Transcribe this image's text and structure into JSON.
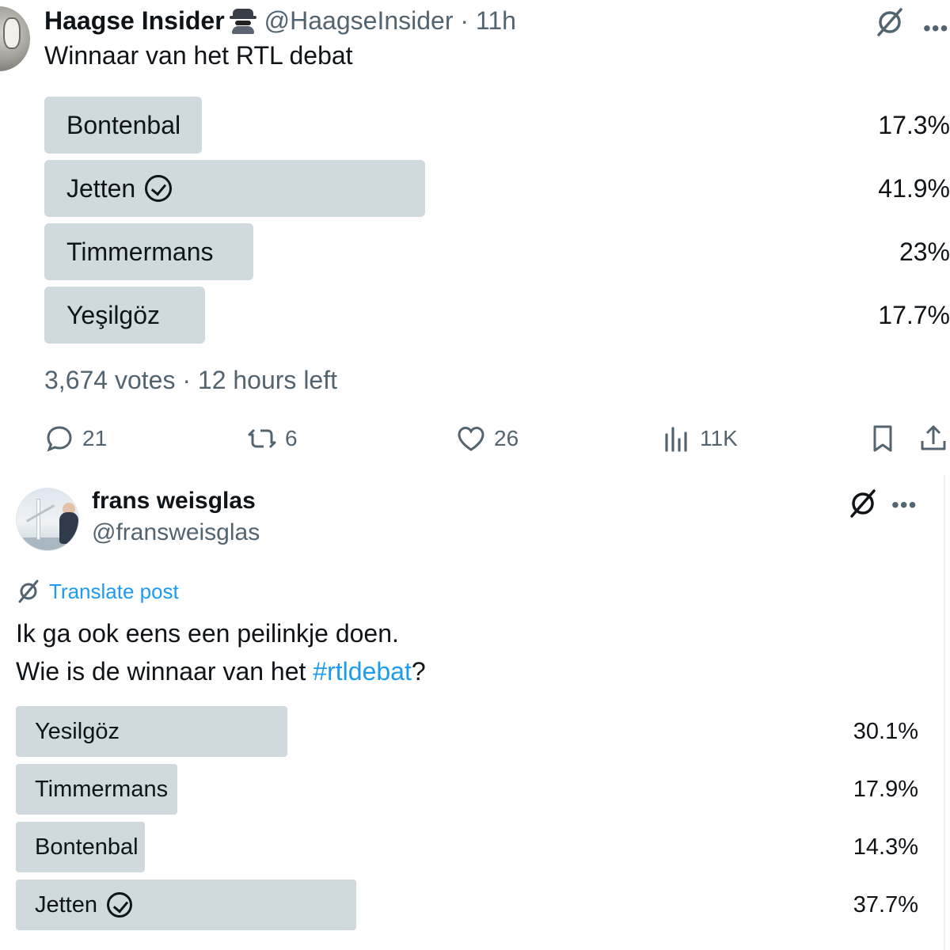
{
  "post1": {
    "display_name": "Haagse Insider",
    "name_emoji_icon": "spy-icon",
    "handle_time": "@HaagseInsider · 11h",
    "question": "Winnaar van het RTL debat",
    "poll": {
      "options": [
        {
          "label": "Bontenbal",
          "percent": "17.3%",
          "value": 17.3,
          "checked": false
        },
        {
          "label": "Jetten",
          "percent": "41.9%",
          "value": 41.9,
          "checked": true
        },
        {
          "label": "Timmermans",
          "percent": "23%",
          "value": 23,
          "checked": false
        },
        {
          "label": "Yeşilgöz",
          "percent": "17.7%",
          "value": 17.7,
          "checked": false
        }
      ],
      "meta": "3,674 votes · 12 hours left"
    },
    "actions": {
      "replies": "21",
      "reposts": "6",
      "likes": "26",
      "views": "11K"
    }
  },
  "post2": {
    "display_name": "frans weisglas",
    "handle": "@fransweisglas",
    "translate_label": "Translate post",
    "text_line1": "Ik ga ook eens een peilinkje doen.",
    "text_line2_prefix": "Wie is de winnaar van het ",
    "hashtag": "#rtldebat",
    "text_line2_suffix": "?",
    "poll": {
      "options": [
        {
          "label": "Yesilgöz",
          "percent": "30.1%",
          "value": 30.1,
          "checked": false
        },
        {
          "label": "Timmermans",
          "percent": "17.9%",
          "value": 17.9,
          "checked": false
        },
        {
          "label": "Bontenbal",
          "percent": "14.3%",
          "value": 14.3,
          "checked": false
        },
        {
          "label": "Jetten",
          "percent": "37.7%",
          "value": 37.7,
          "checked": true
        }
      ]
    }
  },
  "colors": {
    "bar": "#cfd9de",
    "link": "#1d9bf0",
    "secondary_text": "#536471",
    "primary_text": "#0f1419"
  }
}
